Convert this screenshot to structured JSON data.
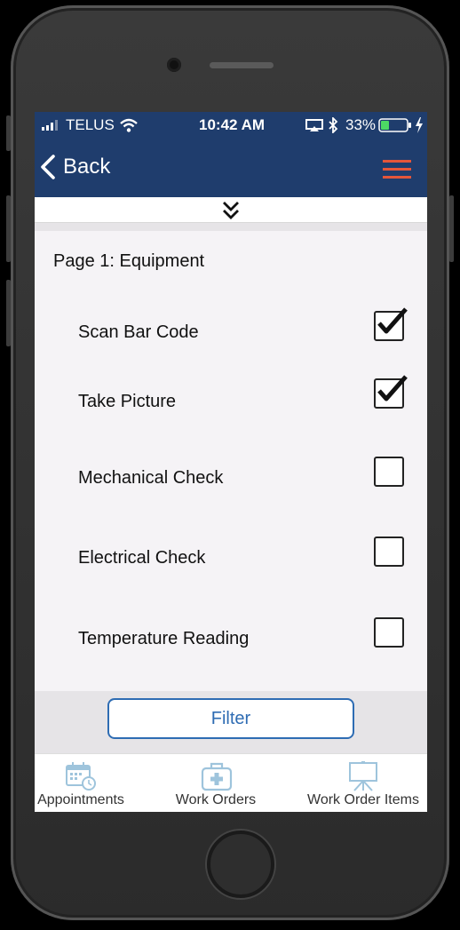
{
  "status_bar": {
    "carrier": "TELUS",
    "time": "10:42 AM",
    "battery_percent": "33%",
    "battery_level": 0.33
  },
  "nav": {
    "back_label": "Back",
    "menu_icon": "hamburger-icon",
    "accent_color": "#e5563a"
  },
  "collapse_icon": "double-chevron-down-icon",
  "section": {
    "title": "Page 1: Equipment",
    "items": [
      {
        "label": "Scan Bar Code",
        "checked": true
      },
      {
        "label": "Take Picture",
        "checked": true
      },
      {
        "label": "Mechanical Check",
        "checked": false
      },
      {
        "label": "Electrical Check",
        "checked": false
      },
      {
        "label": "Temperature Reading",
        "checked": false
      }
    ]
  },
  "filter_label": "Filter",
  "tabs": [
    {
      "label": "Appointments",
      "icon": "calendar-icon"
    },
    {
      "label": "Work Orders",
      "icon": "medical-kit-icon"
    },
    {
      "label": "Work Order Items",
      "icon": "easel-icon"
    }
  ],
  "colors": {
    "header": "#1f3d6d",
    "accent": "#2e6cb3",
    "menu": "#e5563a",
    "tab_icon": "#9ec4dc"
  }
}
